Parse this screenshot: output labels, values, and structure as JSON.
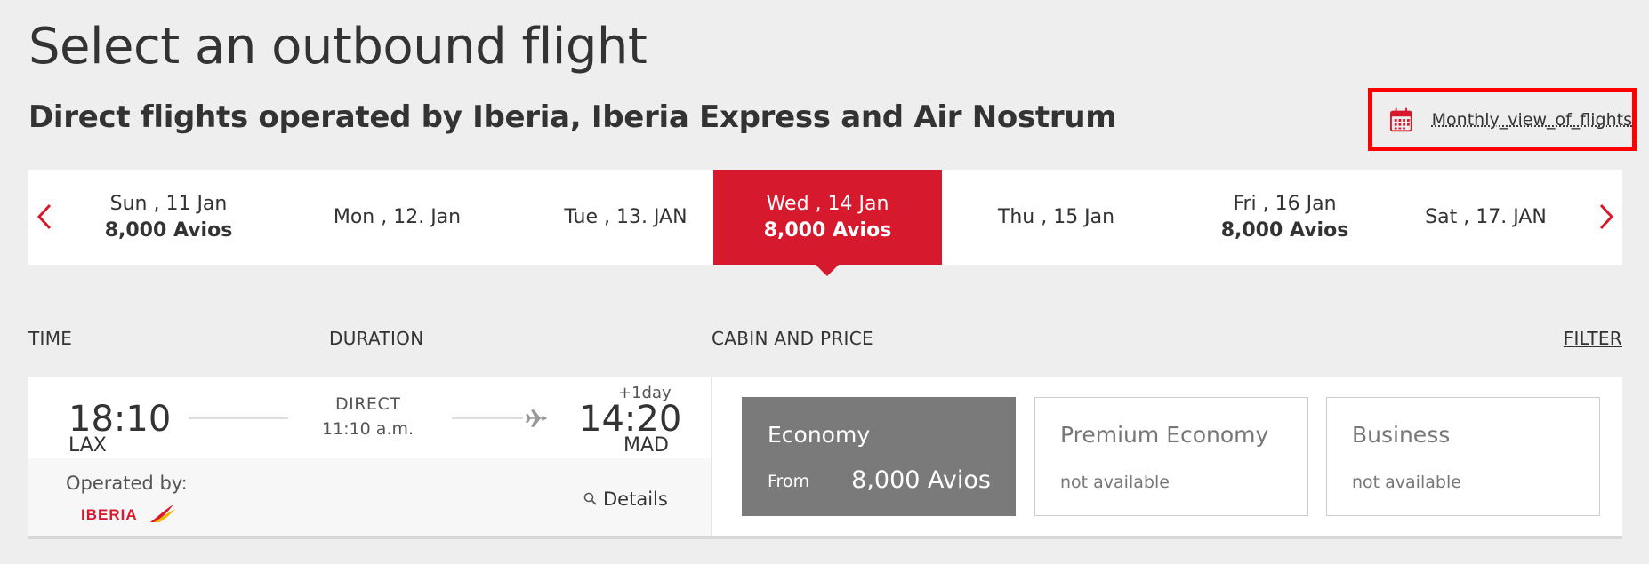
{
  "header": {
    "title": "Select an outbound flight",
    "subtitle": "Direct flights operated by Iberia, Iberia Express and Air Nostrum",
    "monthly_view_label": "Monthly_view_of_flights"
  },
  "date_strip": {
    "days": [
      {
        "label": "Sun , 11 Jan",
        "price": "8,000 Avios",
        "selected": false
      },
      {
        "label": "Mon , 12. Jan",
        "price": "",
        "selected": false
      },
      {
        "label": "Tue , 13. JAN",
        "price": "",
        "selected": false
      },
      {
        "label": "Wed , 14 Jan",
        "price": "8,000 Avios",
        "selected": true
      },
      {
        "label": "Thu , 15 Jan",
        "price": "",
        "selected": false
      },
      {
        "label": "Fri , 16 Jan",
        "price": "8,000 Avios",
        "selected": false
      },
      {
        "label": "Sat , 17. JAN",
        "price": "",
        "selected": false
      }
    ]
  },
  "columns": {
    "time": "TIME",
    "duration": "DURATION",
    "cabin_price": "CABIN AND PRICE",
    "filter": "FILTER"
  },
  "flight": {
    "departure_time": "18:10",
    "departure_code": "LAX",
    "arrival_time": "14:20",
    "arrival_code": "MAD",
    "plus_day": "+1day",
    "type": "DIRECT",
    "duration": "11:10 a.m.",
    "operated_by_label": "Operated by:",
    "operator_logo_text": "IBERIA",
    "details_label": "Details",
    "cabins": [
      {
        "name": "Economy",
        "from_label": "From",
        "price": "8,000 Avios",
        "available": true
      },
      {
        "name": "Premium Economy",
        "status": "not available",
        "available": false
      },
      {
        "name": "Business",
        "status": "not available",
        "available": false
      }
    ]
  },
  "colors": {
    "brand_red": "#d7192d",
    "highlight_border": "#ff0000",
    "economy_bg": "#7a7a7a",
    "page_bg": "#eeeeee"
  },
  "icons": {
    "monthly": "calendar-icon",
    "prev": "chevron-left-icon",
    "next": "chevron-right-icon",
    "plane": "plane-icon",
    "details": "magnifier-icon"
  }
}
